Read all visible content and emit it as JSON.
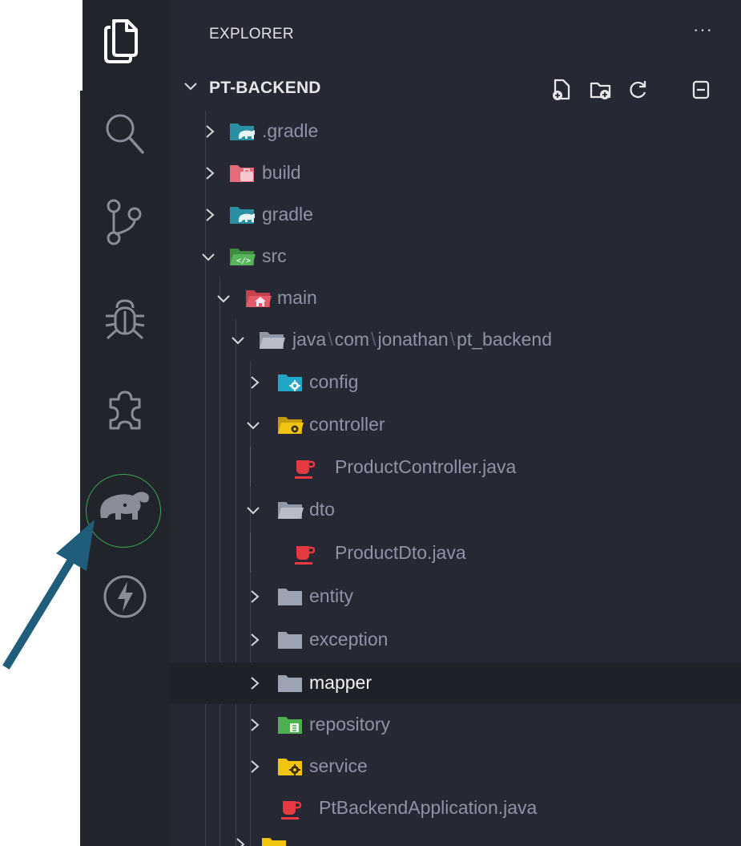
{
  "activity_bar": {
    "items": [
      {
        "name": "explorer",
        "icon": "files-icon",
        "active": true
      },
      {
        "name": "search",
        "icon": "search-icon"
      },
      {
        "name": "source-control",
        "icon": "source-control-icon"
      },
      {
        "name": "run-debug",
        "icon": "bug-icon"
      },
      {
        "name": "extensions",
        "icon": "extensions-icon"
      },
      {
        "name": "gradle",
        "icon": "gradle-elephant-icon",
        "highlighted": true
      },
      {
        "name": "thunder",
        "icon": "lightning-icon"
      }
    ]
  },
  "explorer": {
    "title": "EXPLORER",
    "more": "···",
    "project": {
      "name": "PT-BACKEND",
      "actions": [
        "new-file-icon",
        "new-folder-icon",
        "refresh-icon",
        "collapse-all-icon"
      ]
    },
    "tree": [
      {
        "label": ".gradle",
        "kind": "folder",
        "icon": "gradle-folder-icon",
        "expanded": false
      },
      {
        "label": "build",
        "kind": "folder",
        "icon": "build-folder-icon",
        "expanded": false
      },
      {
        "label": "gradle",
        "kind": "folder",
        "icon": "gradle-folder-icon",
        "expanded": false
      },
      {
        "label": "src",
        "kind": "folder",
        "icon": "src-folder-icon",
        "expanded": true
      },
      {
        "label": "main",
        "kind": "folder",
        "icon": "home-folder-icon",
        "expanded": true
      },
      {
        "segments": [
          "java",
          "com",
          "jonathan",
          "pt_backend"
        ],
        "separator": "\\",
        "kind": "folder",
        "icon": "folder-open-icon",
        "expanded": true
      },
      {
        "label": "config",
        "kind": "folder",
        "icon": "config-folder-icon",
        "expanded": false
      },
      {
        "label": "controller",
        "kind": "folder",
        "icon": "controller-folder-icon",
        "expanded": true
      },
      {
        "label": "ProductController.java",
        "kind": "file",
        "icon": "java-icon"
      },
      {
        "label": "dto",
        "kind": "folder",
        "icon": "folder-open-icon",
        "expanded": true
      },
      {
        "label": "ProductDto.java",
        "kind": "file",
        "icon": "java-icon"
      },
      {
        "label": "entity",
        "kind": "folder",
        "icon": "folder-icon",
        "expanded": false
      },
      {
        "label": "exception",
        "kind": "folder",
        "icon": "folder-icon",
        "expanded": false
      },
      {
        "label": "mapper",
        "kind": "folder",
        "icon": "folder-icon",
        "expanded": false,
        "hovered": true
      },
      {
        "label": "repository",
        "kind": "folder",
        "icon": "repository-folder-icon",
        "expanded": false
      },
      {
        "label": "service",
        "kind": "folder",
        "icon": "service-folder-icon",
        "expanded": false
      },
      {
        "label": "PtBackendApplication.java",
        "kind": "file",
        "icon": "java-icon"
      }
    ]
  },
  "annotation": {
    "icon": "arrow-icon",
    "color": "#1f5d7a",
    "ring_color": "#39a852"
  }
}
